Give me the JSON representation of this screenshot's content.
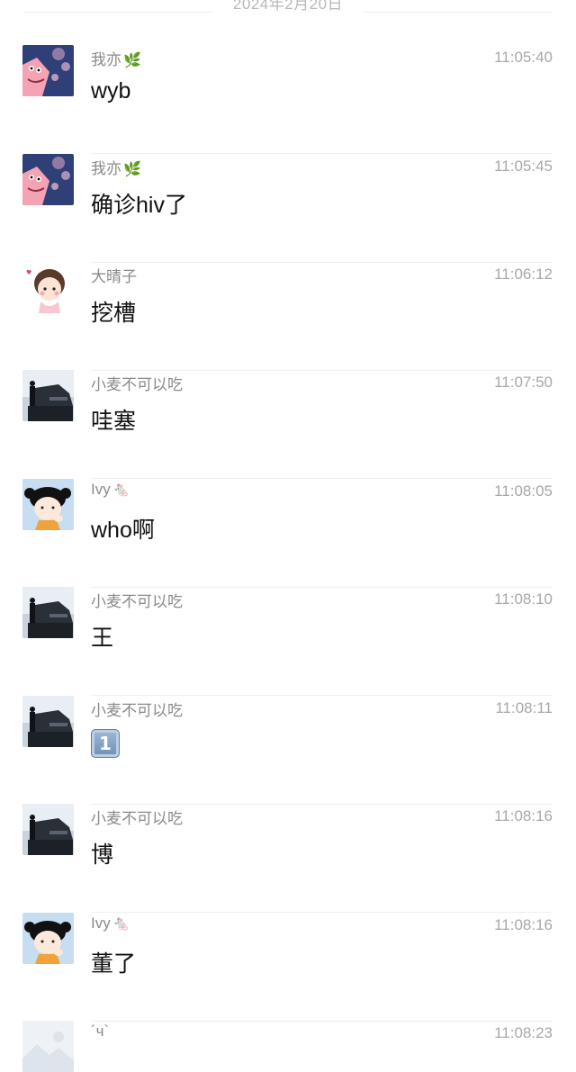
{
  "date_separator": "2024年2月20日",
  "messages": [
    {
      "sender": "我亦",
      "sender_decoration": "leaf",
      "time": "11:05:40",
      "text": "wyb",
      "avatar": "patrick-avatar"
    },
    {
      "sender": "我亦",
      "sender_decoration": "leaf",
      "time": "11:05:45",
      "text": "确诊hiv了",
      "avatar": "patrick-avatar"
    },
    {
      "sender": "大晴子",
      "sender_decoration": "",
      "time": "11:06:12",
      "text": "挖槽",
      "avatar": "cartoon-girl-avatar"
    },
    {
      "sender": "小麦不可以吃",
      "sender_decoration": "",
      "time": "11:07:50",
      "text": "哇塞",
      "avatar": "dark-scene-avatar"
    },
    {
      "sender": "Ivy",
      "sender_decoration": "mouse",
      "time": "11:08:05",
      "text": "who啊",
      "avatar": "cartoon-kid-avatar"
    },
    {
      "sender": "小麦不可以吃",
      "sender_decoration": "",
      "time": "11:08:10",
      "text": "王",
      "avatar": "dark-scene-avatar"
    },
    {
      "sender": "小麦不可以吃",
      "sender_decoration": "",
      "time": "11:08:11",
      "text": "1",
      "text_style": "keycap-emoji",
      "avatar": "dark-scene-avatar"
    },
    {
      "sender": "小麦不可以吃",
      "sender_decoration": "",
      "time": "11:08:16",
      "text": "博",
      "avatar": "dark-scene-avatar"
    },
    {
      "sender": "Ivy",
      "sender_decoration": "mouse",
      "time": "11:08:16",
      "text": "董了",
      "avatar": "cartoon-kid-avatar"
    },
    {
      "sender": "´ч`",
      "sender_decoration": "",
      "time": "11:08:23",
      "text": "",
      "avatar": "placeholder-image-avatar"
    }
  ],
  "icons": {
    "leaf": "leaf-icon",
    "mouse": "mouse-icon"
  }
}
